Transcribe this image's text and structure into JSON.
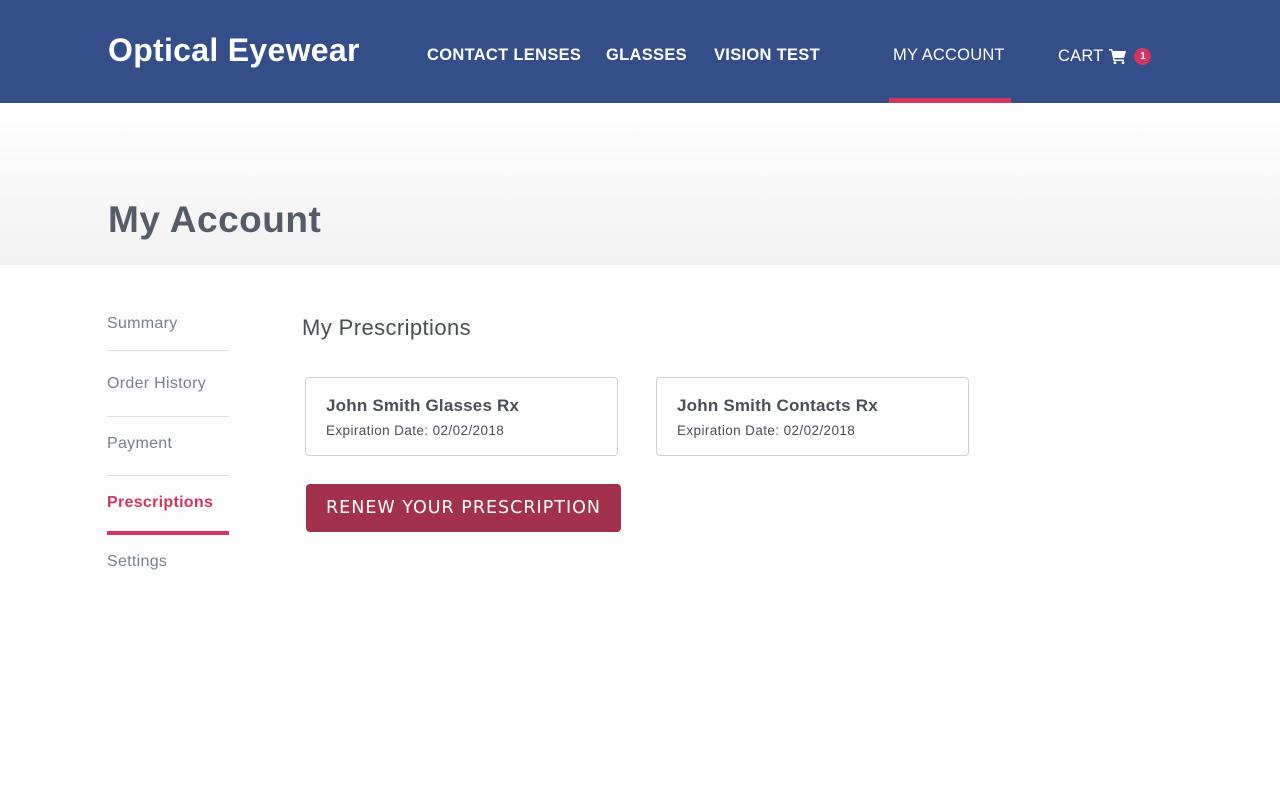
{
  "header": {
    "logo": "Optical Eyewear",
    "nav": {
      "contact_lenses": "CONTACT LENSES",
      "glasses": "GLASSES",
      "vision_test": "VISION TEST",
      "my_account": "MY ACCOUNT",
      "cart": "CART",
      "cart_count": "1"
    },
    "cart_icon": "shopping-cart-icon"
  },
  "hero": {
    "title": "My Account"
  },
  "sidebar": {
    "items": [
      {
        "label": "Summary"
      },
      {
        "label": "Order History"
      },
      {
        "label": "Payment"
      },
      {
        "label": "Prescriptions",
        "active": true
      },
      {
        "label": "Settings"
      }
    ]
  },
  "main": {
    "title": "My Prescriptions",
    "prescriptions": [
      {
        "name": "John Smith Glasses Rx",
        "expiration": "Expiration Date: 02/02/2018"
      },
      {
        "name": "John Smith Contacts Rx",
        "expiration": "Expiration Date: 02/02/2018"
      }
    ],
    "renew_button": "RENEW YOUR PRESCRIPTION"
  },
  "colors": {
    "header_bg": "#344e8a",
    "accent": "#d2365f",
    "button": "#a3314c",
    "text": "#555c68"
  }
}
